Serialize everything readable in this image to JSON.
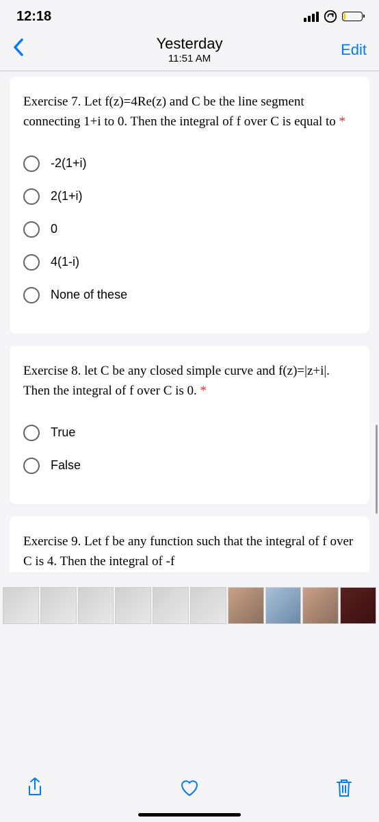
{
  "status": {
    "time": "12:18"
  },
  "nav": {
    "title": "Yesterday",
    "subtitle": "11:51 AM",
    "edit": "Edit"
  },
  "q7": {
    "text": "Exercise 7. Let f(z)=4Re(z) and C be the line segment connecting 1+i to 0. Then the integral of f over C is equal to ",
    "opts": {
      "a": "-2(1+i)",
      "b": "2(1+i)",
      "c": "0",
      "d": "4(1-i)",
      "e": "None of these"
    }
  },
  "q8": {
    "text": "Exercise 8. let C be any closed simple curve and f(z)=|z+i|. Then the integral of f over C is 0. ",
    "opts": {
      "a": "True",
      "b": "False"
    }
  },
  "q9": {
    "text": "Exercise 9. Let f be any function such that the integral of f over C is 4. Then the integral of -f"
  },
  "star": "*"
}
